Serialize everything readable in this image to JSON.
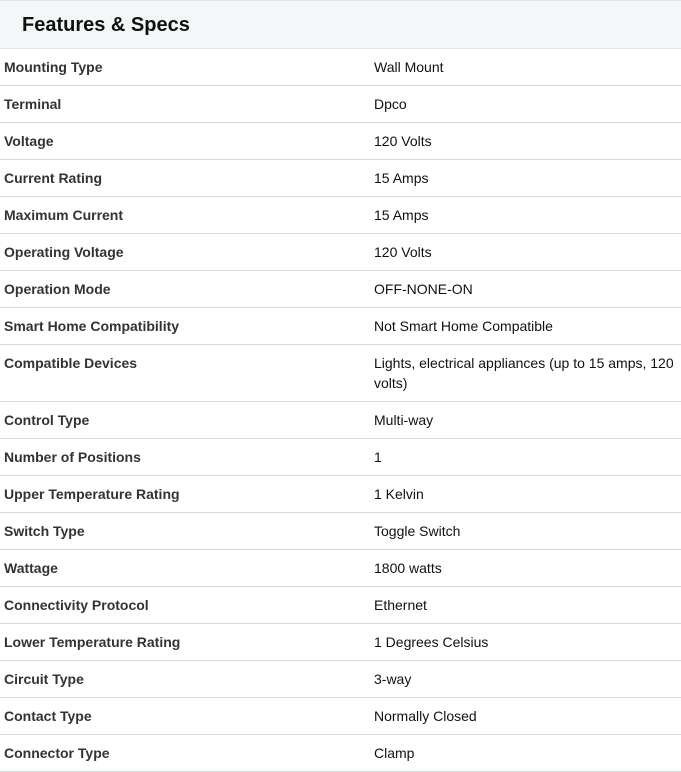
{
  "section": {
    "title": "Features & Specs"
  },
  "specs": [
    {
      "label": "Mounting Type",
      "value": "Wall Mount"
    },
    {
      "label": "Terminal",
      "value": "Dpco"
    },
    {
      "label": "Voltage",
      "value": "120 Volts"
    },
    {
      "label": "Current Rating",
      "value": "15 Amps"
    },
    {
      "label": "Maximum Current",
      "value": "15 Amps"
    },
    {
      "label": "Operating Voltage",
      "value": "120 Volts"
    },
    {
      "label": "Operation Mode",
      "value": "OFF-NONE-ON"
    },
    {
      "label": "Smart Home Compatibility",
      "value": "Not Smart Home Compatible"
    },
    {
      "label": "Compatible Devices",
      "value": "Lights, electrical appliances (up to 15 amps, 120 volts)"
    },
    {
      "label": "Control Type",
      "value": "Multi-way"
    },
    {
      "label": "Number of Positions",
      "value": "1"
    },
    {
      "label": "Upper Temperature Rating",
      "value": "1 Kelvin"
    },
    {
      "label": "Switch Type",
      "value": "Toggle Switch"
    },
    {
      "label": "Wattage",
      "value": "1800 watts"
    },
    {
      "label": "Connectivity Protocol",
      "value": "Ethernet"
    },
    {
      "label": "Lower Temperature Rating",
      "value": "1 Degrees Celsius"
    },
    {
      "label": "Circuit Type",
      "value": "3-way"
    },
    {
      "label": "Contact Type",
      "value": "Normally Closed"
    },
    {
      "label": "Connector Type",
      "value": "Clamp"
    }
  ]
}
